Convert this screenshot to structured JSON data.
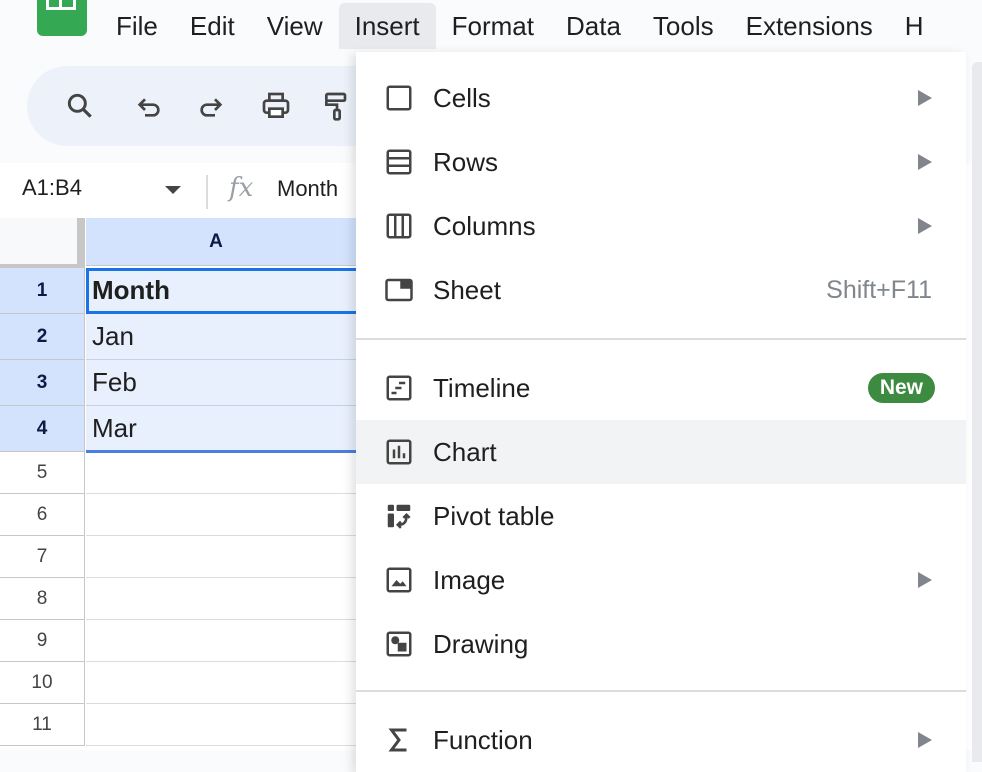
{
  "app": {
    "logo": "sheets-logo",
    "menubar": [
      "File",
      "Edit",
      "View",
      "Insert",
      "Format",
      "Data",
      "Tools",
      "Extensions",
      "H"
    ],
    "active_menu": "Insert"
  },
  "toolbar": {
    "icons": [
      "search-icon",
      "undo-icon",
      "redo-icon",
      "print-icon",
      "paint-format-icon"
    ]
  },
  "formula_bar": {
    "name_box": "A1:B4",
    "fx_label": "fx",
    "value": "Month"
  },
  "grid": {
    "column_headers": [
      "A"
    ],
    "rows": [
      {
        "num": "1",
        "a": "Month",
        "selected": true,
        "bold": true
      },
      {
        "num": "2",
        "a": "Jan",
        "selected": true
      },
      {
        "num": "3",
        "a": "Feb",
        "selected": true
      },
      {
        "num": "4",
        "a": "Mar",
        "selected": true
      },
      {
        "num": "5",
        "a": ""
      },
      {
        "num": "6",
        "a": ""
      },
      {
        "num": "7",
        "a": ""
      },
      {
        "num": "8",
        "a": ""
      },
      {
        "num": "9",
        "a": ""
      },
      {
        "num": "10",
        "a": ""
      },
      {
        "num": "11",
        "a": ""
      }
    ]
  },
  "insert_menu": {
    "items": [
      {
        "label": "Cells",
        "icon": "cells-icon",
        "submenu": true
      },
      {
        "label": "Rows",
        "icon": "rows-icon",
        "submenu": true
      },
      {
        "label": "Columns",
        "icon": "columns-icon",
        "submenu": true
      },
      {
        "label": "Sheet",
        "icon": "sheet-icon",
        "shortcut": "Shift+F11"
      },
      {
        "label": "Timeline",
        "icon": "timeline-icon",
        "badge": "New"
      },
      {
        "label": "Chart",
        "icon": "chart-icon",
        "hovered": true
      },
      {
        "label": "Pivot table",
        "icon": "pivot-table-icon"
      },
      {
        "label": "Image",
        "icon": "image-icon",
        "submenu": true
      },
      {
        "label": "Drawing",
        "icon": "drawing-icon"
      },
      {
        "label": "Function",
        "icon": "function-icon",
        "submenu": true
      }
    ]
  },
  "colors": {
    "accent": "#1a73e8",
    "selection_header": "#d3e3fd",
    "badge_green": "#3d8b40",
    "logo_green": "#34a853"
  }
}
